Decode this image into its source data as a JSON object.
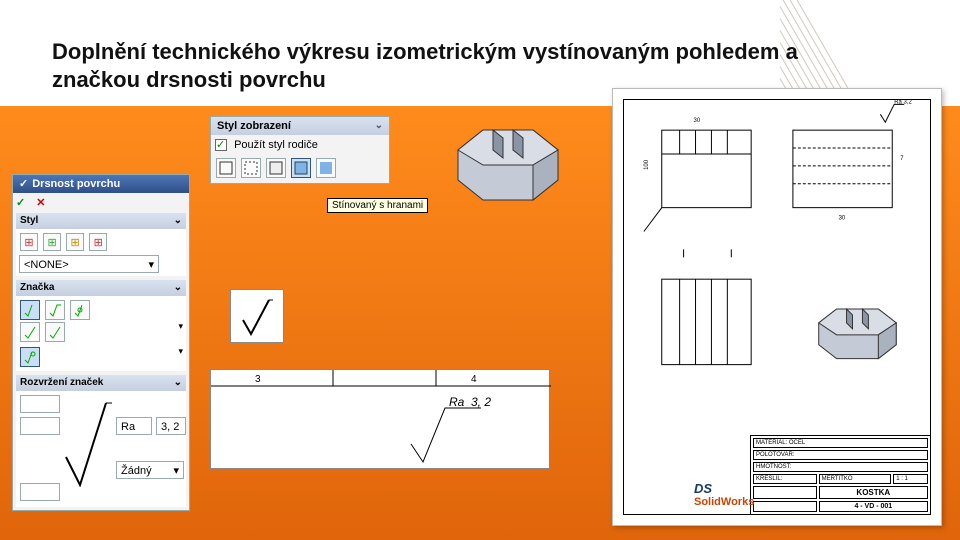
{
  "title": "Doplnění technického výkresu izometrickým vystínovaným pohledem a značkou drsnosti povrchu",
  "style_panel": {
    "header": "Styl zobrazení",
    "checkbox_label": "Použít styl rodiče",
    "tooltip": "Stínovaný s hranami"
  },
  "surface_panel": {
    "header": "Drsnost povrchu",
    "ok_glyph": "✓",
    "cancel_glyph": "✕",
    "style_hdr": "Styl",
    "style_value": "<NONE>",
    "symbol_hdr": "Značka",
    "layout_hdr": "Rozvržení značek",
    "field_ra": "Ra",
    "field_val": "3, 2",
    "field_none": "Žádný"
  },
  "detail_label": "Ra  3, 2",
  "titleblock": {
    "r1a": "MERTITKO",
    "r1b": "1 : 1",
    "name": "KOSTKA",
    "num": "4 - VD - 001",
    "row_a": "MATERIÁL: OCEL",
    "row_b": "POLOTOVAR:",
    "row_c": "HMOTNOST:",
    "row_d": "KRESLIL:"
  },
  "logo": {
    "ds": "DS",
    "sw": "SolidWorks"
  },
  "dims": {
    "a": "30",
    "b": "100",
    "c": "30",
    "d": "7"
  },
  "axis": {
    "a": "3",
    "b": "4"
  }
}
